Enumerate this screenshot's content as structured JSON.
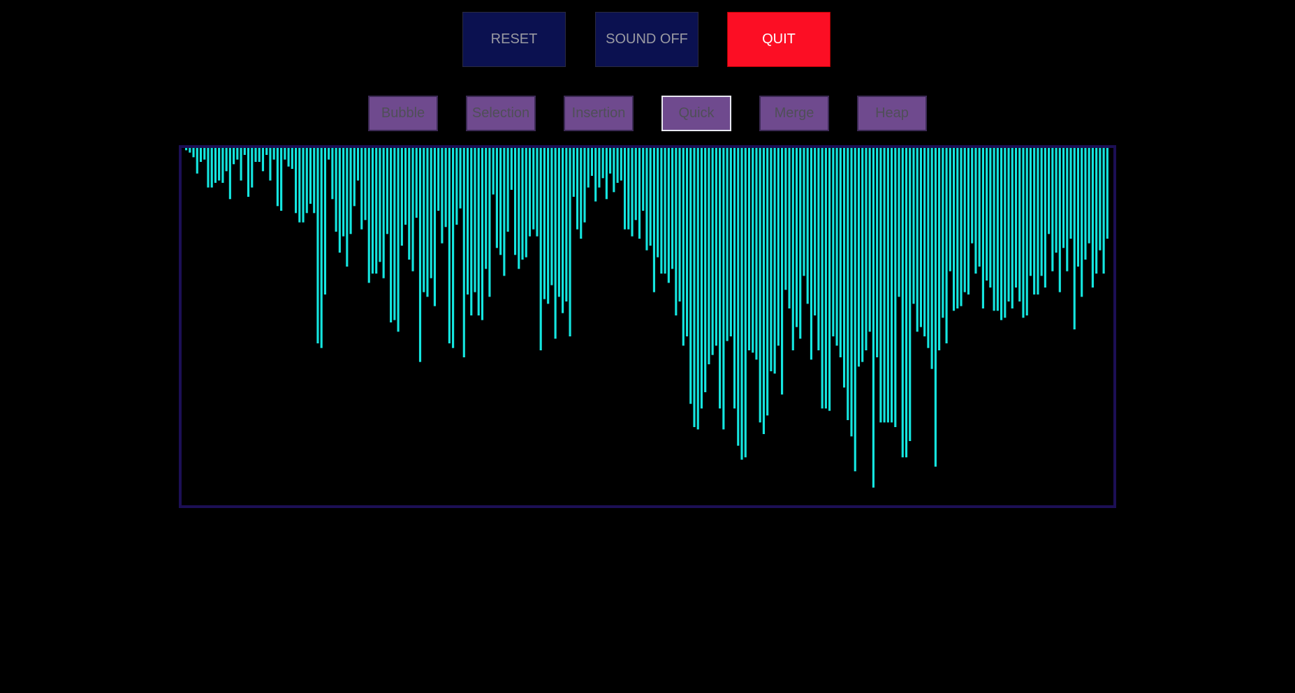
{
  "controls": {
    "reset_label": "RESET",
    "sound_label": "SOUND OFF",
    "quit_label": "QUIT"
  },
  "algorithms": [
    {
      "label": "Bubble",
      "selected": false
    },
    {
      "label": "Selection",
      "selected": false
    },
    {
      "label": "Insertion",
      "selected": false
    },
    {
      "label": "Quick",
      "selected": true
    },
    {
      "label": "Merge",
      "selected": false
    },
    {
      "label": "Heap",
      "selected": false
    }
  ],
  "colors": {
    "bar": "#14e6e0",
    "frame": "#1c0f55",
    "quit": "#fc0e24",
    "control_bg": "#0b1150",
    "algo_bg": "#6f4a8e"
  },
  "chart_data": {
    "type": "bar",
    "orientation": "hanging-from-top",
    "ylim": [
      0,
      100
    ],
    "values": [
      1,
      2,
      4,
      11,
      6,
      5,
      17,
      17,
      15,
      14,
      15,
      10,
      22,
      7,
      5,
      14,
      3,
      21,
      17,
      6,
      6,
      10,
      3,
      14,
      5,
      25,
      27,
      5,
      8,
      9,
      28,
      32,
      32,
      28,
      24,
      28,
      84,
      86,
      63,
      5,
      22,
      36,
      45,
      38,
      51,
      37,
      25,
      14,
      35,
      31,
      58,
      54,
      54,
      49,
      56,
      37,
      75,
      74,
      79,
      42,
      33,
      48,
      53,
      30,
      92,
      62,
      64,
      56,
      68,
      27,
      41,
      34,
      84,
      86,
      33,
      26,
      90,
      63,
      72,
      62,
      72,
      74,
      52,
      64,
      20,
      43,
      46,
      55,
      36,
      18,
      46,
      52,
      48,
      47,
      38,
      35,
      38,
      87,
      65,
      67,
      59,
      82,
      64,
      71,
      66,
      81,
      21,
      35,
      39,
      32,
      17,
      12,
      23,
      17,
      13,
      22,
      11,
      19,
      15,
      14,
      35,
      35,
      38,
      31,
      39,
      27,
      44,
      42,
      62,
      47,
      54,
      54,
      58,
      52,
      72,
      66,
      85,
      81,
      110,
      120,
      121,
      112,
      105,
      93,
      89,
      85,
      112,
      121,
      83,
      81,
      112,
      128,
      134,
      133,
      87,
      88,
      91,
      118,
      123,
      115,
      96,
      97,
      85,
      106,
      61,
      69,
      87,
      77,
      82,
      55,
      67,
      91,
      72,
      87,
      112,
      112,
      113,
      81,
      85,
      90,
      103,
      117,
      124,
      139,
      94,
      92,
      87,
      79,
      146,
      90,
      118,
      118,
      118,
      118,
      120,
      64,
      133,
      133,
      126,
      67,
      79,
      77,
      81,
      86,
      95,
      137,
      87,
      73,
      84,
      53,
      70,
      69,
      68,
      62,
      63,
      41,
      54,
      51,
      69,
      57,
      60,
      70,
      70,
      74,
      73,
      66,
      69,
      60,
      66,
      73,
      72,
      55,
      63,
      63,
      55,
      60,
      37,
      53,
      45,
      62,
      43,
      53,
      39,
      78,
      51,
      64,
      48,
      41,
      60,
      54,
      44,
      54,
      39
    ]
  }
}
